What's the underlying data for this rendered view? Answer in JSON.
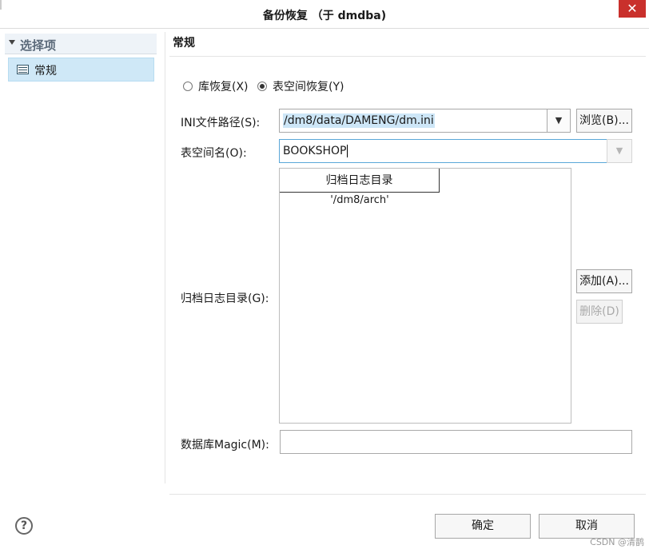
{
  "window": {
    "title": "备份恢复 （于 dmdba)",
    "close_glyph": "✕"
  },
  "sidebar": {
    "header": "选择项",
    "items": [
      {
        "label": "常规",
        "selected": true
      }
    ]
  },
  "main": {
    "section_title": "常规",
    "radio_options": [
      {
        "label": "库恢复(X)",
        "checked": false
      },
      {
        "label": "表空间恢复(Y)",
        "checked": true
      }
    ],
    "ini_path": {
      "label": "INI文件路径(S):",
      "value": "/dm8/data/DAMENG/dm.ini",
      "browse_label": "浏览(B)..."
    },
    "tablespace": {
      "label": "表空间名(O):",
      "value": "BOOKSHOP"
    },
    "archive": {
      "label": "归档日志目录(G):",
      "column_header": "归档日志目录",
      "rows": [
        "'/dm8/arch'"
      ],
      "add_label": "添加(A)...",
      "delete_label": "删除(D)"
    },
    "magic": {
      "label": "数据库Magic(M):",
      "value": ""
    }
  },
  "footer": {
    "help_glyph": "?",
    "ok_label": "确定",
    "cancel_label": "取消",
    "watermark": "CSDN @清鹊"
  },
  "icons": {
    "dropdown": "▼",
    "sidebar_expand": "triangle-down-icon",
    "sidebar_item": "table-icon"
  }
}
